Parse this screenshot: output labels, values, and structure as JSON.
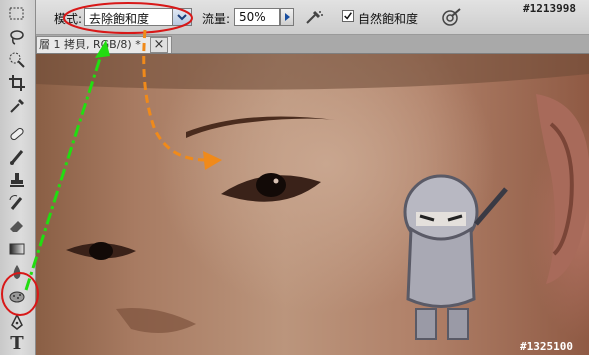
{
  "options_bar": {
    "mode_label": "模式:",
    "mode_value": "去除飽和度",
    "flow_label": "流量:",
    "flow_value": "50%",
    "vibrance_label": "自然飽和度",
    "vibrance_checked": true
  },
  "document_tab": {
    "title": "層 1 拷貝, RGB/8) *",
    "close_glyph": "×"
  },
  "watermarks": {
    "top": "#1213998",
    "bottom": "#1325100"
  },
  "toolbox": {
    "tools": [
      "marquee",
      "lasso",
      "quick-selection",
      "crop",
      "eyedropper",
      "spot-healing",
      "brush",
      "clone-stamp",
      "history-brush",
      "eraser",
      "gradient",
      "blur",
      "sponge",
      "pen",
      "type"
    ],
    "text_tool_glyph": "T"
  },
  "annotations": {
    "circle_color": "#d81818",
    "green_arrow_color": "#22dd11",
    "orange_arrow_color": "#f08a1a"
  }
}
